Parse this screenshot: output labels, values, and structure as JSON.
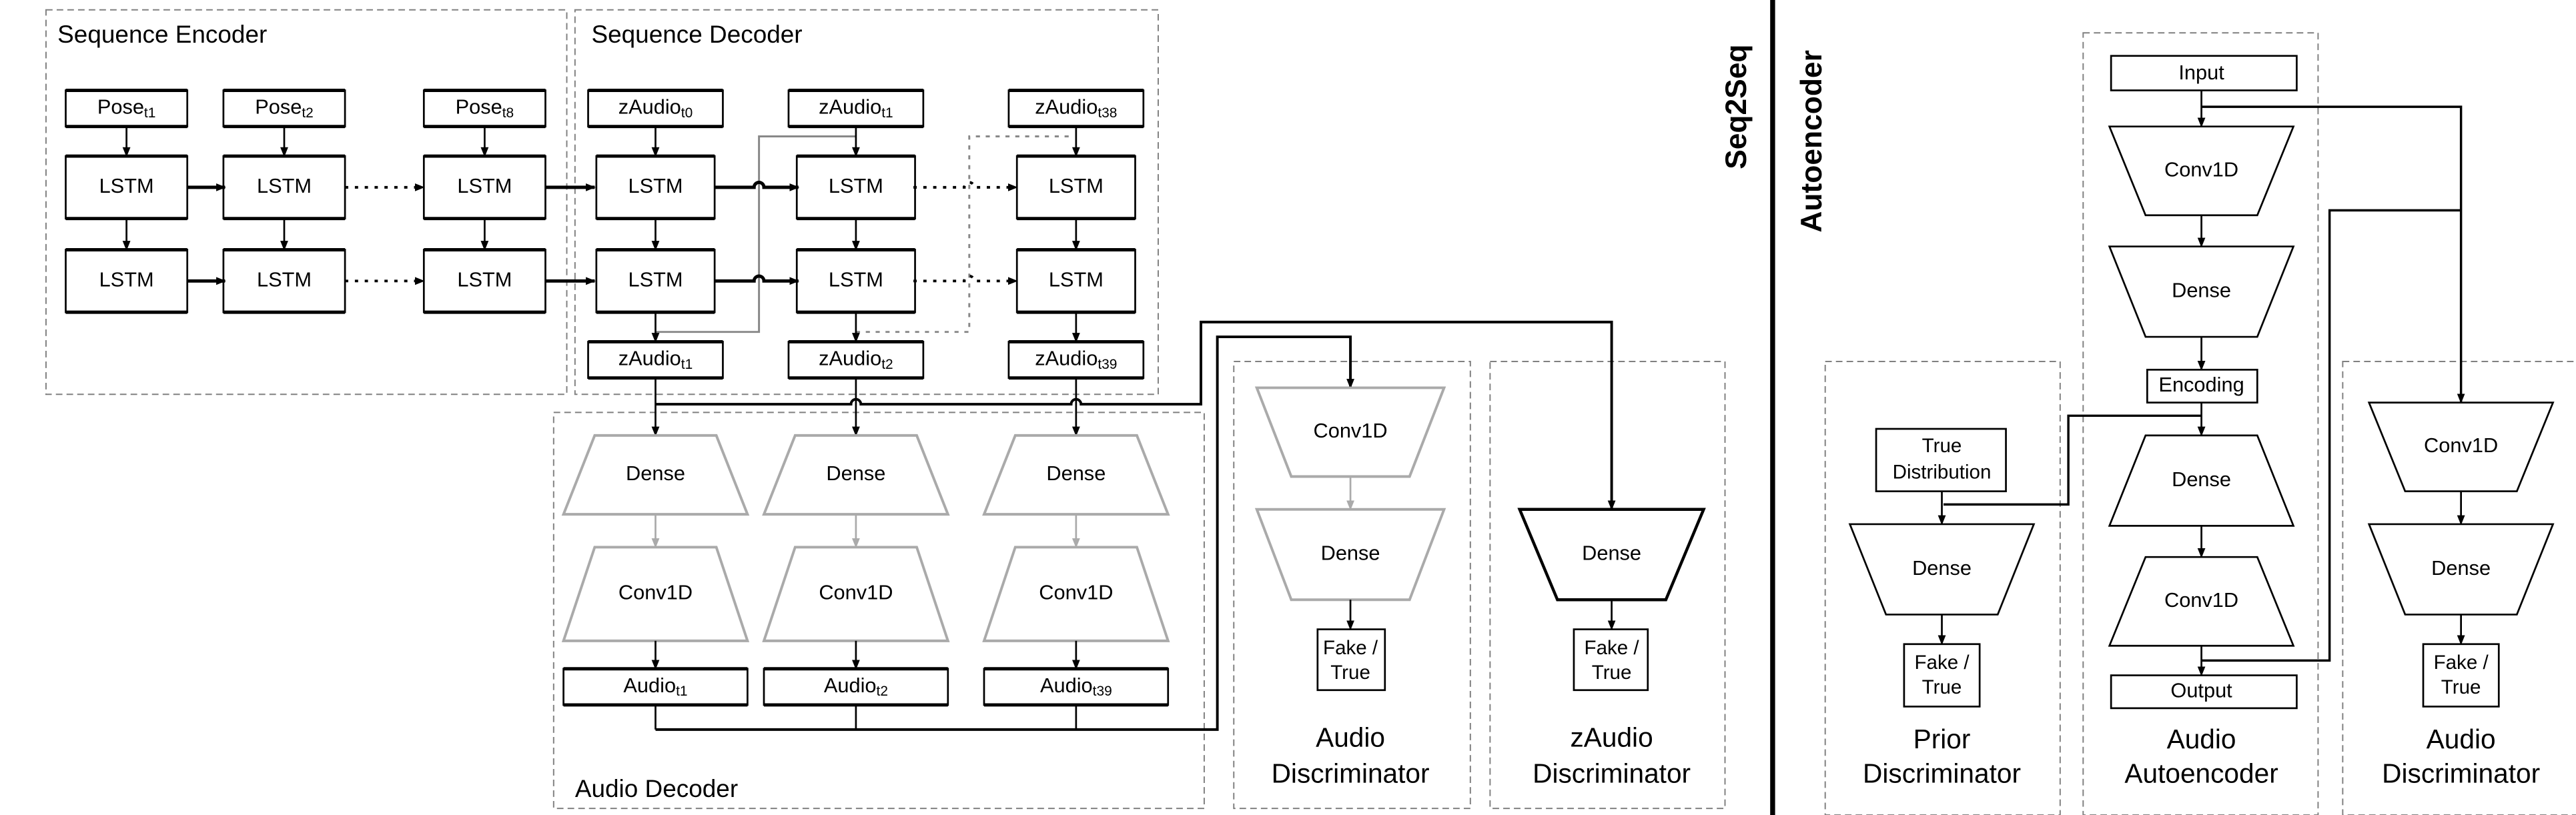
{
  "seq2seq_label": "Seq2Seq",
  "autoencoder_label": "Autoencoder",
  "sequence_encoder": {
    "title": "Sequence Encoder",
    "cell": "LSTM",
    "inputs": [
      {
        "base": "Pose",
        "sub": "t1"
      },
      {
        "base": "Pose",
        "sub": "t2"
      },
      {
        "base": "Pose",
        "sub": "t8"
      }
    ]
  },
  "sequence_decoder": {
    "title": "Sequence Decoder",
    "cell": "LSTM",
    "inputs": [
      {
        "base": "zAudio",
        "sub": "t0"
      },
      {
        "base": "zAudio",
        "sub": "t1"
      },
      {
        "base": "zAudio",
        "sub": "t38"
      }
    ],
    "outputs": [
      {
        "base": "zAudio",
        "sub": "t1"
      },
      {
        "base": "zAudio",
        "sub": "t2"
      },
      {
        "base": "zAudio",
        "sub": "t39"
      }
    ]
  },
  "audio_decoder": {
    "title": "Audio  Decoder",
    "layers": [
      "Dense",
      "Conv1D"
    ],
    "outputs": [
      {
        "base": "Audio",
        "sub": "t1"
      },
      {
        "base": "Audio",
        "sub": "t2"
      },
      {
        "base": "Audio",
        "sub": "t39"
      }
    ]
  },
  "audio_discriminator": {
    "title_lines": [
      "Audio",
      "Discriminator"
    ],
    "layers": [
      "Conv1D",
      "Dense"
    ],
    "output_lines": [
      "Fake /",
      "True"
    ]
  },
  "zaudio_discriminator": {
    "title_lines": [
      "zAudio",
      "Discriminator"
    ],
    "layers": [
      "Dense"
    ],
    "output_lines": [
      "Fake /",
      "True"
    ]
  },
  "prior_discriminator": {
    "title_lines": [
      "Prior",
      "Discriminator"
    ],
    "input_lines": [
      "True",
      "Distribution"
    ],
    "layers": [
      "Dense"
    ],
    "output_lines": [
      "Fake /",
      "True"
    ]
  },
  "audio_autoencoder": {
    "title_lines": [
      "Audio",
      "Autoencoder"
    ],
    "input": "Input",
    "encoder_layers": [
      "Conv1D",
      "Dense"
    ],
    "encoding": "Encoding",
    "decoder_layers": [
      "Dense",
      "Conv1D"
    ],
    "output": "Output"
  },
  "ae_audio_discriminator": {
    "title_lines": [
      "Audio",
      "Discriminator"
    ],
    "layers": [
      "Conv1D",
      "Dense"
    ],
    "output_lines": [
      "Fake /",
      "True"
    ]
  },
  "colors": {
    "line": "#000000",
    "inactive": "#aaaaaa",
    "dashed_border": "#808080"
  }
}
